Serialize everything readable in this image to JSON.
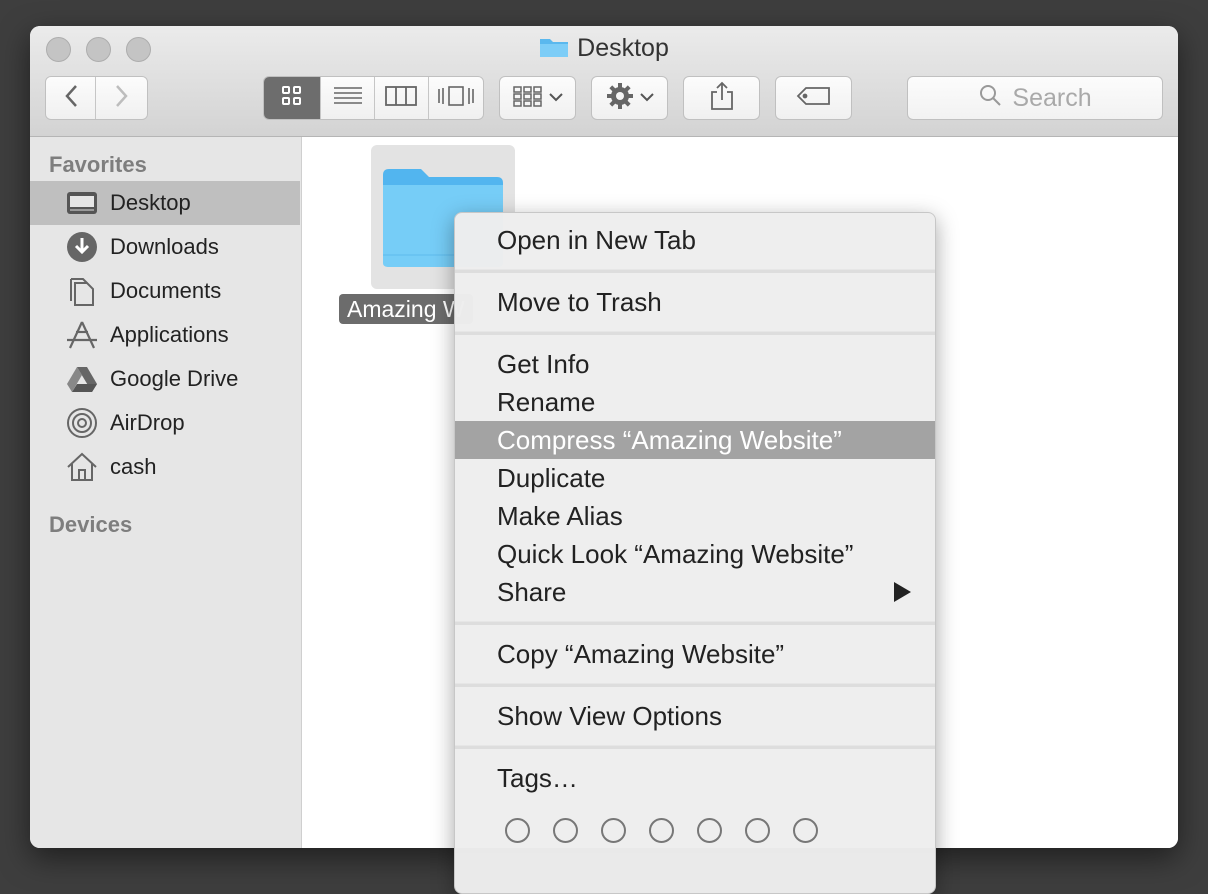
{
  "window": {
    "title": "Desktop"
  },
  "toolbar": {
    "back_icon": "chevron-left-icon",
    "forward_icon": "chevron-right-icon",
    "view_modes": [
      "icon-view",
      "list-view",
      "column-view",
      "cover-flow-view"
    ],
    "active_view": "icon-view",
    "search_placeholder": "Search"
  },
  "sidebar": {
    "favorites_header": "Favorites",
    "items": [
      {
        "label": "Desktop",
        "icon": "desktop-icon",
        "selected": true
      },
      {
        "label": "Downloads",
        "icon": "downloads-icon"
      },
      {
        "label": "Documents",
        "icon": "documents-icon"
      },
      {
        "label": "Applications",
        "icon": "applications-icon"
      },
      {
        "label": "Google Drive",
        "icon": "google-drive-icon"
      },
      {
        "label": "AirDrop",
        "icon": "airdrop-icon"
      },
      {
        "label": "cash",
        "icon": "home-icon"
      }
    ],
    "devices_header": "Devices"
  },
  "content": {
    "file": {
      "label": "Amazing W",
      "icon": "folder-icon"
    }
  },
  "context_menu": {
    "items": [
      {
        "label": "Open in New Tab"
      },
      {
        "label": "Move to Trash"
      },
      {
        "label": "Get Info"
      },
      {
        "label": "Rename"
      },
      {
        "label": "Compress “Amazing Website”",
        "highlighted": true
      },
      {
        "label": "Duplicate"
      },
      {
        "label": "Make Alias"
      },
      {
        "label": "Quick Look “Amazing Website”"
      },
      {
        "label": "Share",
        "submenu": true
      },
      {
        "label": "Copy “Amazing Website”"
      },
      {
        "label": "Show View Options"
      },
      {
        "label": "Tags…"
      }
    ],
    "tag_count": 7
  },
  "colors": {
    "highlight": "#a3a3a3",
    "folder_blue": "#6cc6f5",
    "selected_sidebar": "#bfbfbf"
  }
}
